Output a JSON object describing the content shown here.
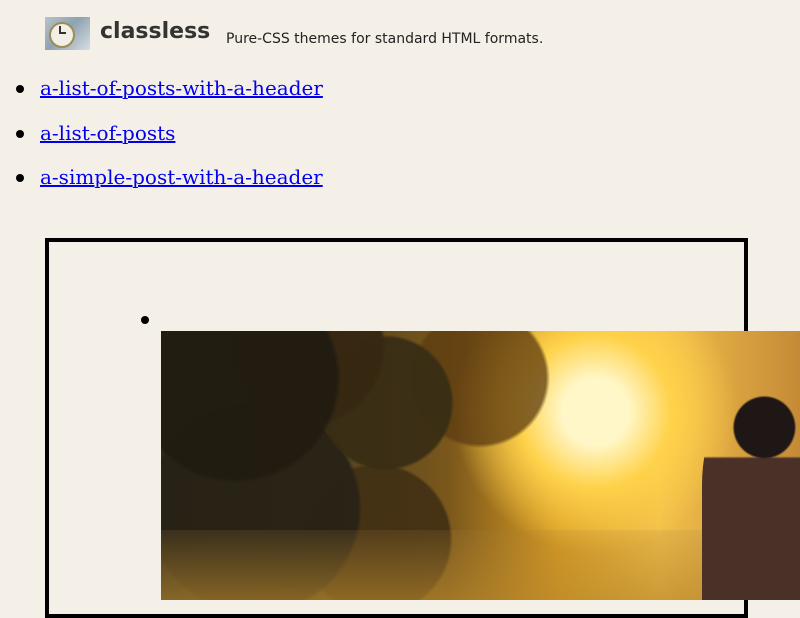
{
  "header": {
    "site_title": "classless",
    "tagline": "Pure-CSS themes for standard HTML formats.",
    "logo_icon": "clock-icon"
  },
  "posts": [
    {
      "label": "a-list-of-posts-with-a-header"
    },
    {
      "label": "a-list-of-posts"
    },
    {
      "label": "a-simple-post-with-a-header"
    }
  ],
  "preview": {
    "bullet_icon": "bullet-icon",
    "image_icon": "sunset-person-photo"
  }
}
